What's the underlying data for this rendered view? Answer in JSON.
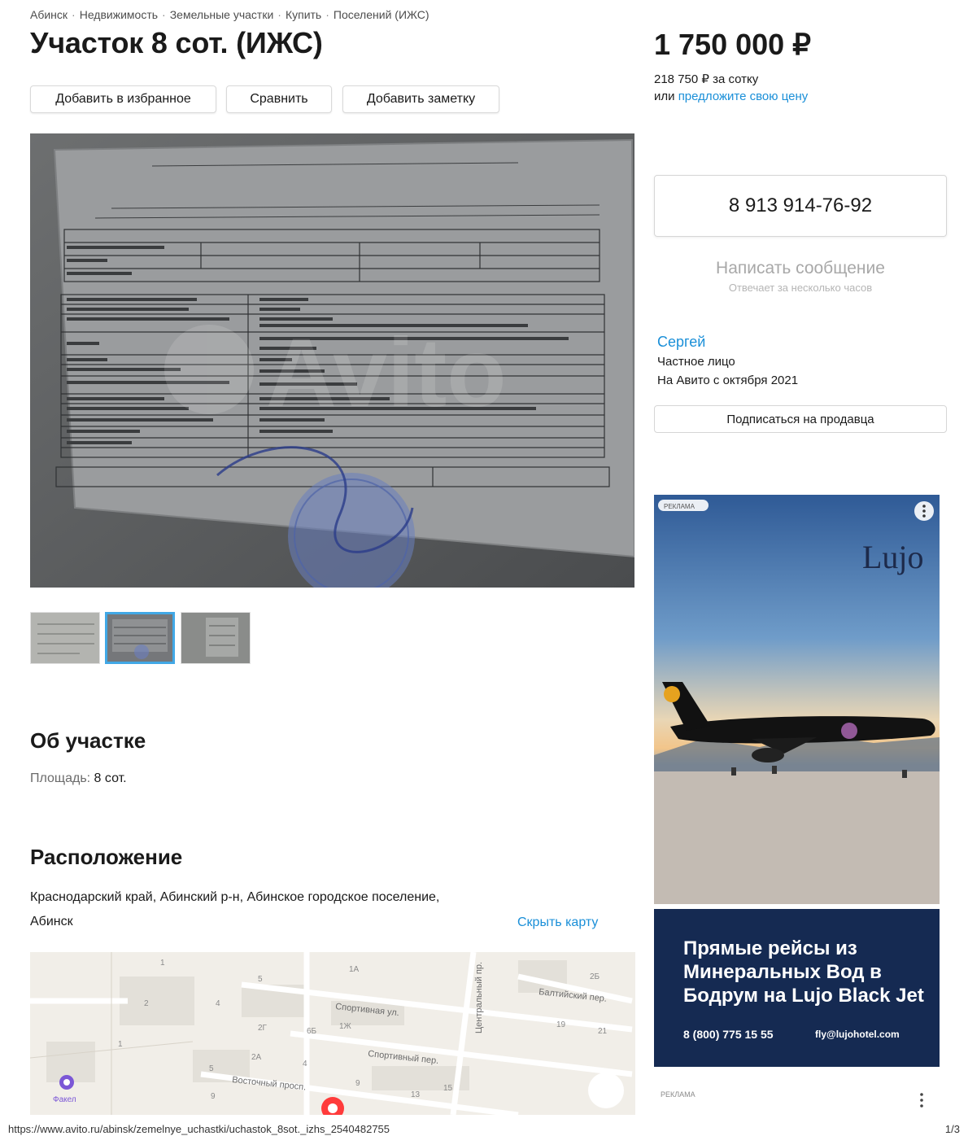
{
  "breadcrumbs": [
    "Абинск",
    "Недвижимость",
    "Земельные участки",
    "Купить",
    "Поселений (ИЖС)"
  ],
  "title": "Участок 8 сот. (ИЖС)",
  "actions": {
    "favorite": "Добавить в избранное",
    "compare": "Сравнить",
    "note": "Добавить заметку"
  },
  "price": {
    "value": "1 750 000 ₽",
    "per_unit": "218 750 ₽ за сотку",
    "offer_prefix": "или",
    "offer_link": "предложите свою цену"
  },
  "contact": {
    "phone": "8 913 914-76-92",
    "message_button": "Написать сообщение",
    "response_time": "Отвечает за несколько часов"
  },
  "seller": {
    "name": "Сергей",
    "type": "Частное лицо",
    "since": "На Авито с октября 2021",
    "subscribe": "Подписаться на продавца"
  },
  "gallery": {
    "selected_index": 1
  },
  "about": {
    "heading": "Об участке",
    "area_label": "Площадь:",
    "area_value": "8 сот."
  },
  "location": {
    "heading": "Расположение",
    "address_line1": "Краснодарский край, Абинский р-н, Абинское городское поселение,",
    "address_line2": "Абинск",
    "hide_map": "Скрыть карту"
  },
  "map": {
    "streets": [
      "Спортивная ул.",
      "Спортивный пер.",
      "Балтийский пер.",
      "Восточный просп.",
      "Центральный пр."
    ],
    "house_numbers": [
      "1",
      "5",
      "1А",
      "2",
      "4",
      "2Г",
      "6Б",
      "1Ж",
      "2А",
      "4",
      "9",
      "13",
      "15",
      "19",
      "21",
      "2Б",
      "1",
      "5",
      "9"
    ],
    "poi": "Факел"
  },
  "ads": {
    "badge": "РЕКЛАМА",
    "brand": "Lujo",
    "headline_1": "Прямые рейсы из",
    "headline_2": "Минеральных Вод в",
    "headline_3": "Бодрум на Lujo Black Jet",
    "phone": "8 (800) 775 15 55",
    "email": "fly@lujohotel.com",
    "badge2": "РЕКЛАМА"
  },
  "footer": {
    "url": "https://www.avito.ru/abinsk/zemelnye_uchastki/uchastok_8sot._izhs_2540482755",
    "page": "1/3"
  },
  "colors": {
    "link": "#1a8fd8",
    "ad_blue": "#152a52"
  }
}
